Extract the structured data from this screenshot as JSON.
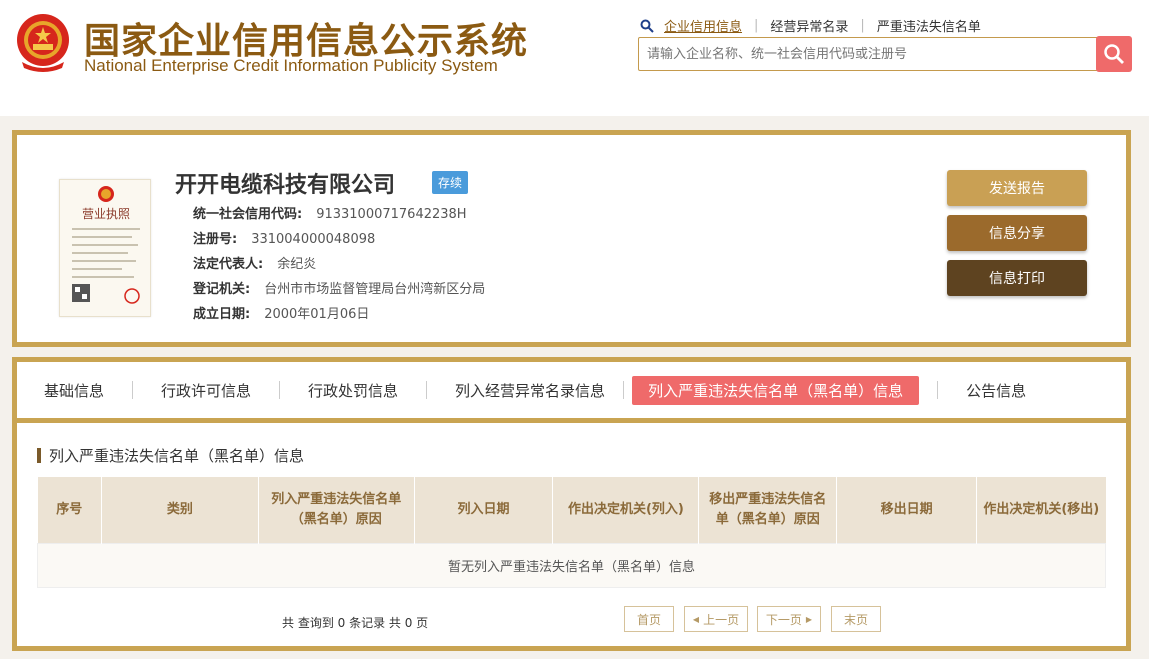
{
  "header": {
    "title_cn": "国家企业信用信息公示系统",
    "title_en": "National Enterprise Credit Information Publicity System",
    "links": [
      "企业信用信息",
      "经营异常名录",
      "严重违法失信名单"
    ],
    "search_placeholder": "请输入企业名称、统一社会信用代码或注册号"
  },
  "company": {
    "name": "开开电缆科技有限公司",
    "status": "存续",
    "license_title": "营业执照",
    "fields": [
      {
        "label": "统一社会信用代码:",
        "value": "91331000717642238H"
      },
      {
        "label": "注册号:",
        "value": "331004000048098"
      },
      {
        "label": "法定代表人:",
        "value": "余纪炎"
      },
      {
        "label": "登记机关:",
        "value": "台州市市场监督管理局台州湾新区分局"
      },
      {
        "label": "成立日期:",
        "value": "2000年01月06日"
      }
    ],
    "actions": [
      "发送报告",
      "信息分享",
      "信息打印"
    ]
  },
  "tabs": [
    "基础信息",
    "行政许可信息",
    "行政处罚信息",
    "列入经营异常名录信息",
    "列入严重违法失信名单（黑名单）信息",
    "公告信息"
  ],
  "section": {
    "title": "列入严重违法失信名单（黑名单）信息",
    "columns": [
      "序号",
      "类别",
      "列入严重违法失信名单（黑名单）原因",
      "列入日期",
      "作出决定机关(列入)",
      "移出严重违法失信名单（黑名单）原因",
      "移出日期",
      "作出决定机关(移出)"
    ],
    "empty_text": "暂无列入严重违法失信名单（黑名单）信息"
  },
  "pager": {
    "summary": "共 查询到 0 条记录 共 0 页",
    "first": "首页",
    "prev": "上一页",
    "next": "下一页",
    "last": "末页"
  },
  "colors": {
    "brand": "#8b5a12",
    "border_gold": "#c9a452",
    "accent_red": "#ef6a6a",
    "badge_blue": "#4a9bdb",
    "btn1": "#c9a054",
    "btn2": "#9b6a2c",
    "btn3": "#5e4320"
  }
}
